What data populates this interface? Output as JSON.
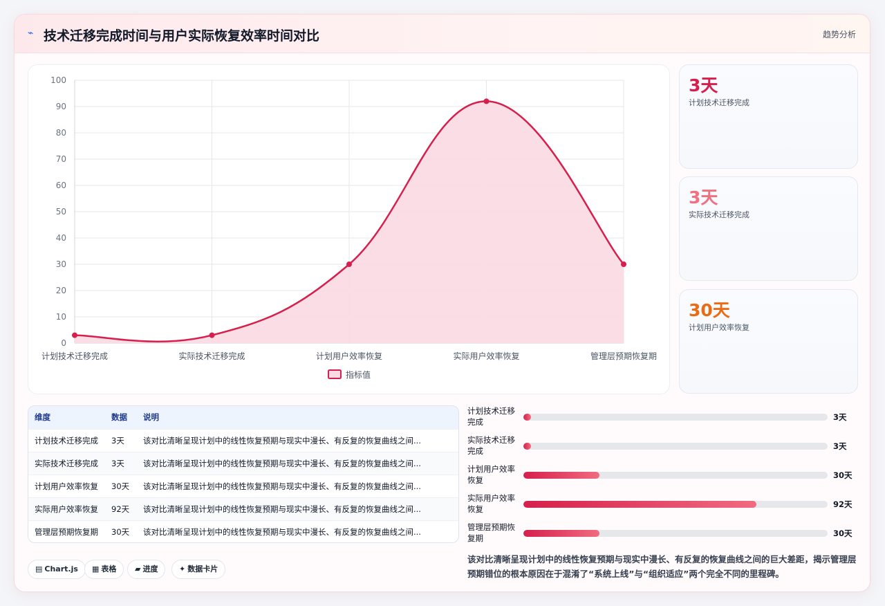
{
  "header": {
    "icon": "activity-icon",
    "title": "技术迁移完成时间与用户实际恢复效率时间对比",
    "right_label": "趋势分析"
  },
  "colors": {
    "line": "#d61f4c",
    "area": "#fadbe4",
    "accent1": "#d61f4c",
    "accent2": "#f07080",
    "accent3": "#ea6b12"
  },
  "chart_data": {
    "type": "area",
    "categories": [
      "计划技术迁移完成",
      "实际技术迁移完成",
      "计划用户效率恢复",
      "实际用户效率恢复",
      "管理层预期恢复期"
    ],
    "series": [
      {
        "name": "指标值",
        "values": [
          3,
          3,
          30,
          92,
          30
        ]
      }
    ],
    "ylim": [
      0,
      100
    ],
    "yticks": [
      0,
      10,
      20,
      30,
      40,
      50,
      60,
      70,
      80,
      90,
      100
    ],
    "grid": true,
    "legend": "bottom",
    "smooth": true
  },
  "stats": [
    {
      "value": "3天",
      "label": "计划技术迁移完成",
      "color": "#d61f4c"
    },
    {
      "value": "3天",
      "label": "实际技术迁移完成",
      "color": "#f07080"
    },
    {
      "value": "30天",
      "label": "计划用户效率恢复",
      "color": "#ea6b12"
    }
  ],
  "table": {
    "headers": [
      "维度",
      "数据",
      "说明"
    ],
    "rows": [
      {
        "dim": "计划技术迁移完成",
        "val": "3天",
        "desc": "该对比清晰呈现计划中的线性恢复预期与现实中漫长、有反复的恢复曲线之间..."
      },
      {
        "dim": "实际技术迁移完成",
        "val": "3天",
        "desc": "该对比清晰呈现计划中的线性恢复预期与现实中漫长、有反复的恢复曲线之间..."
      },
      {
        "dim": "计划用户效率恢复",
        "val": "30天",
        "desc": "该对比清晰呈现计划中的线性恢复预期与现实中漫长、有反复的恢复曲线之间..."
      },
      {
        "dim": "实际用户效率恢复",
        "val": "92天",
        "desc": "该对比清晰呈现计划中的线性恢复预期与现实中漫长、有反复的恢复曲线之间..."
      },
      {
        "dim": "管理层预期恢复期",
        "val": "30天",
        "desc": "该对比清晰呈现计划中的线性恢复预期与现实中漫长、有反复的恢复曲线之间..."
      }
    ]
  },
  "bars": {
    "max": 120,
    "items": [
      {
        "label": "计划技术迁移完成",
        "value": 3,
        "display": "3天"
      },
      {
        "label": "实际技术迁移完成",
        "value": 3,
        "display": "3天"
      },
      {
        "label": "计划用户效率恢复",
        "value": 30,
        "display": "30天"
      },
      {
        "label": "实际用户效率恢复",
        "value": 92,
        "display": "92天"
      },
      {
        "label": "管理层预期恢复期",
        "value": 30,
        "display": "30天"
      }
    ]
  },
  "chips": [
    {
      "icon": "chart-icon",
      "glyph": "▤",
      "label": "Chart.js"
    },
    {
      "icon": "table-icon",
      "glyph": "▦",
      "label": "表格"
    },
    {
      "icon": "progress-icon",
      "glyph": "▰",
      "label": "进度"
    },
    {
      "icon": "sparkle-icon",
      "glyph": "✦",
      "label": "数据卡片"
    }
  ],
  "summary": "该对比清晰呈现计划中的线性恢复预期与现实中漫长、有反复的恢复曲线之间的巨大差距，揭示管理层预期错位的根本原因在于混淆了“系统上线”与“组织适应”两个完全不同的里程碑。"
}
